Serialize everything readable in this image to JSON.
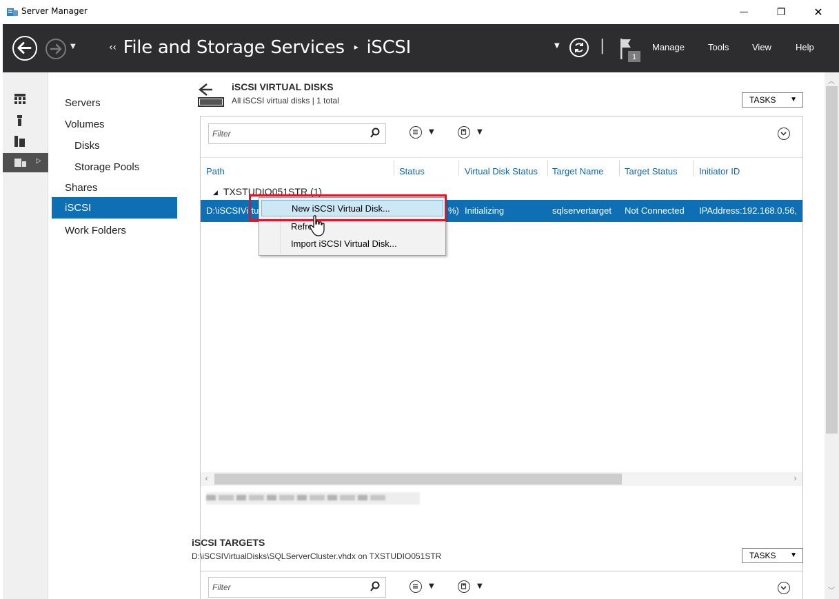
{
  "window": {
    "title": "Server Manager",
    "controls": {
      "minimize": "—",
      "restore": "❐",
      "close": "✕"
    }
  },
  "header": {
    "breadcrumb_prefix": "‹‹",
    "breadcrumb_root": "File and Storage Services",
    "breadcrumb_sep": "▸",
    "breadcrumb_current": "iSCSI",
    "notification_count": "1",
    "menus": [
      "Manage",
      "Tools",
      "View",
      "Help"
    ]
  },
  "sidebar": {
    "items": [
      {
        "label": "Servers",
        "sub": false,
        "active": false
      },
      {
        "label": "Volumes",
        "sub": false,
        "active": false
      },
      {
        "label": "Disks",
        "sub": true,
        "active": false
      },
      {
        "label": "Storage Pools",
        "sub": true,
        "active": false
      },
      {
        "label": "Shares",
        "sub": false,
        "active": false
      },
      {
        "label": "iSCSI",
        "sub": false,
        "active": true
      },
      {
        "label": "Work Folders",
        "sub": false,
        "active": false
      }
    ]
  },
  "virtual_disks": {
    "title": "iSCSI VIRTUAL DISKS",
    "subtitle": "All iSCSI virtual disks | 1 total",
    "tasks_label": "TASKS",
    "filter_placeholder": "Filter",
    "columns": [
      "Path",
      "Status",
      "Virtual Disk Status",
      "Target Name",
      "Target Status",
      "Initiator ID"
    ],
    "group_label": "TXSTUDIO051STR (1)",
    "row": {
      "path": "D:\\iSCSIVirtu",
      "status_tail": "%)",
      "virtual_disk_status": "Initializing",
      "target_name": "sqlservertarget",
      "target_status": "Not Connected",
      "initiator_id": "IPAddress:192.168.0.56,"
    }
  },
  "context_menu": {
    "items": [
      "New iSCSI Virtual Disk...",
      "Refre",
      "Import iSCSI Virtual Disk..."
    ]
  },
  "targets": {
    "title": "iSCSI TARGETS",
    "subtitle": "D:\\iSCSIVirtualDisks\\SQLServerCluster.vhdx on TXSTUDIO051STR",
    "tasks_label": "TASKS",
    "filter_placeholder": "Filter"
  },
  "colors": {
    "header_bg": "#2d2d30",
    "selection": "#0e6fb4",
    "column_header": "#1664a8",
    "highlight_box": "#e81123"
  }
}
